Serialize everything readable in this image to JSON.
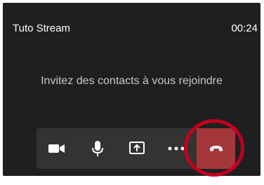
{
  "window": {
    "title": "Tuto Stream",
    "timer": "00:24"
  },
  "main": {
    "invite_text": "Invitez des contacts à vous rejoindre"
  },
  "toolbar": {
    "buttons": [
      {
        "icon": "camera-icon"
      },
      {
        "icon": "microphone-icon"
      },
      {
        "icon": "share-screen-icon"
      },
      {
        "icon": "more-options-icon"
      }
    ],
    "hangup": {
      "icon": "hang-up-icon",
      "color": "#a4373a"
    }
  },
  "annotation": {
    "color": "#c0001e"
  },
  "colors": {
    "background": "#1f1f1f",
    "toolbar": "#333333",
    "text": "#ffffff"
  }
}
